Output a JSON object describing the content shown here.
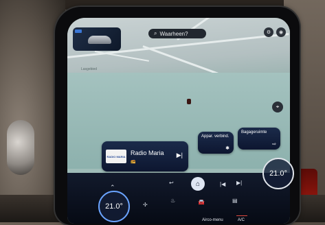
{
  "navigation": {
    "search_placeholder": "Waarheen?"
  },
  "map": {
    "labels": [
      "Lasgebied"
    ]
  },
  "media": {
    "station_logo": "RADIO MARIA",
    "station_name": "Radio Maria",
    "source_icon": "radio-icon",
    "next_symbol": "▶|"
  },
  "shortcuts": [
    {
      "label": "Appar. verbind.",
      "icon": "bluetooth-icon",
      "symbol": "✱"
    },
    {
      "label": "Bagageruimte",
      "icon": "trunk-icon",
      "symbol": "⇨"
    }
  ],
  "climate": {
    "left_temp": "21.0°",
    "right_temp": "21.0°",
    "airco_menu_label": "Airco-menu",
    "ac_label": "A/C"
  },
  "controls": {
    "prev_symbol": "|◀",
    "next_symbol": "▶|",
    "back_symbol": "↩",
    "home_symbol": "⌂"
  },
  "colors": {
    "accent_blue": "#6aa3ff",
    "ac_active": "#e04a3f",
    "card_bg": "#1b2b4a"
  }
}
